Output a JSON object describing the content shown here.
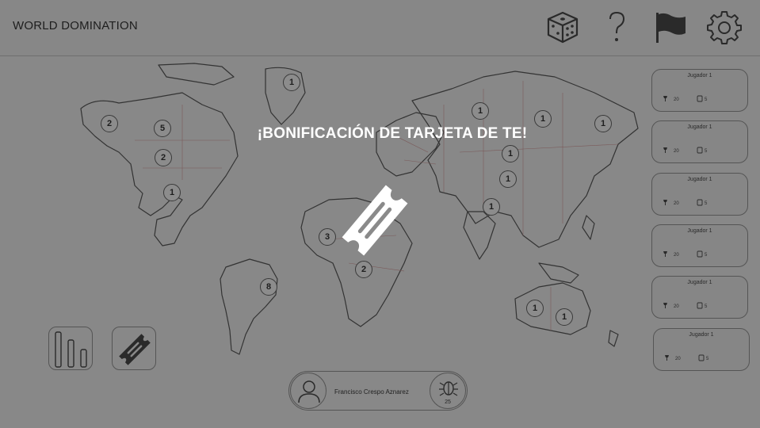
{
  "app": {
    "title": "WORLD DOMINATION"
  },
  "toolbar": {
    "icons": [
      "dice-icon",
      "help-icon",
      "flag-icon",
      "settings-icon"
    ]
  },
  "overlay": {
    "title": "¡BONIFICACIÓN DE TARJETA DE TE!",
    "icon": "card-ticket-icon"
  },
  "territories": [
    {
      "label": "1"
    },
    {
      "label": "2"
    },
    {
      "label": "5"
    },
    {
      "label": "2"
    },
    {
      "label": "1"
    },
    {
      "label": "3"
    },
    {
      "label": "2"
    },
    {
      "label": "8"
    },
    {
      "label": "1"
    },
    {
      "label": "1"
    },
    {
      "label": "1"
    },
    {
      "label": "1"
    },
    {
      "label": "1"
    },
    {
      "label": "1"
    },
    {
      "label": "1"
    },
    {
      "label": "1"
    }
  ],
  "players": [
    {
      "name": "Jugador 1",
      "troops": "20",
      "cards": "5"
    },
    {
      "name": "Jugador 1",
      "troops": "20",
      "cards": "5"
    },
    {
      "name": "Jugador 1",
      "troops": "20",
      "cards": "5"
    },
    {
      "name": "Jugador 1",
      "troops": "20",
      "cards": "5"
    },
    {
      "name": "Jugador 1",
      "troops": "20",
      "cards": "5"
    },
    {
      "name": "Jugador 1",
      "troops": "20",
      "cards": "5"
    }
  ],
  "current_player": {
    "name": "Francisco Crespo Aznarez",
    "troops": "25"
  },
  "colors": {
    "overlay": "#888888",
    "text": "#1e1e1e",
    "highlight": "#ffffff",
    "border": "#555555"
  }
}
